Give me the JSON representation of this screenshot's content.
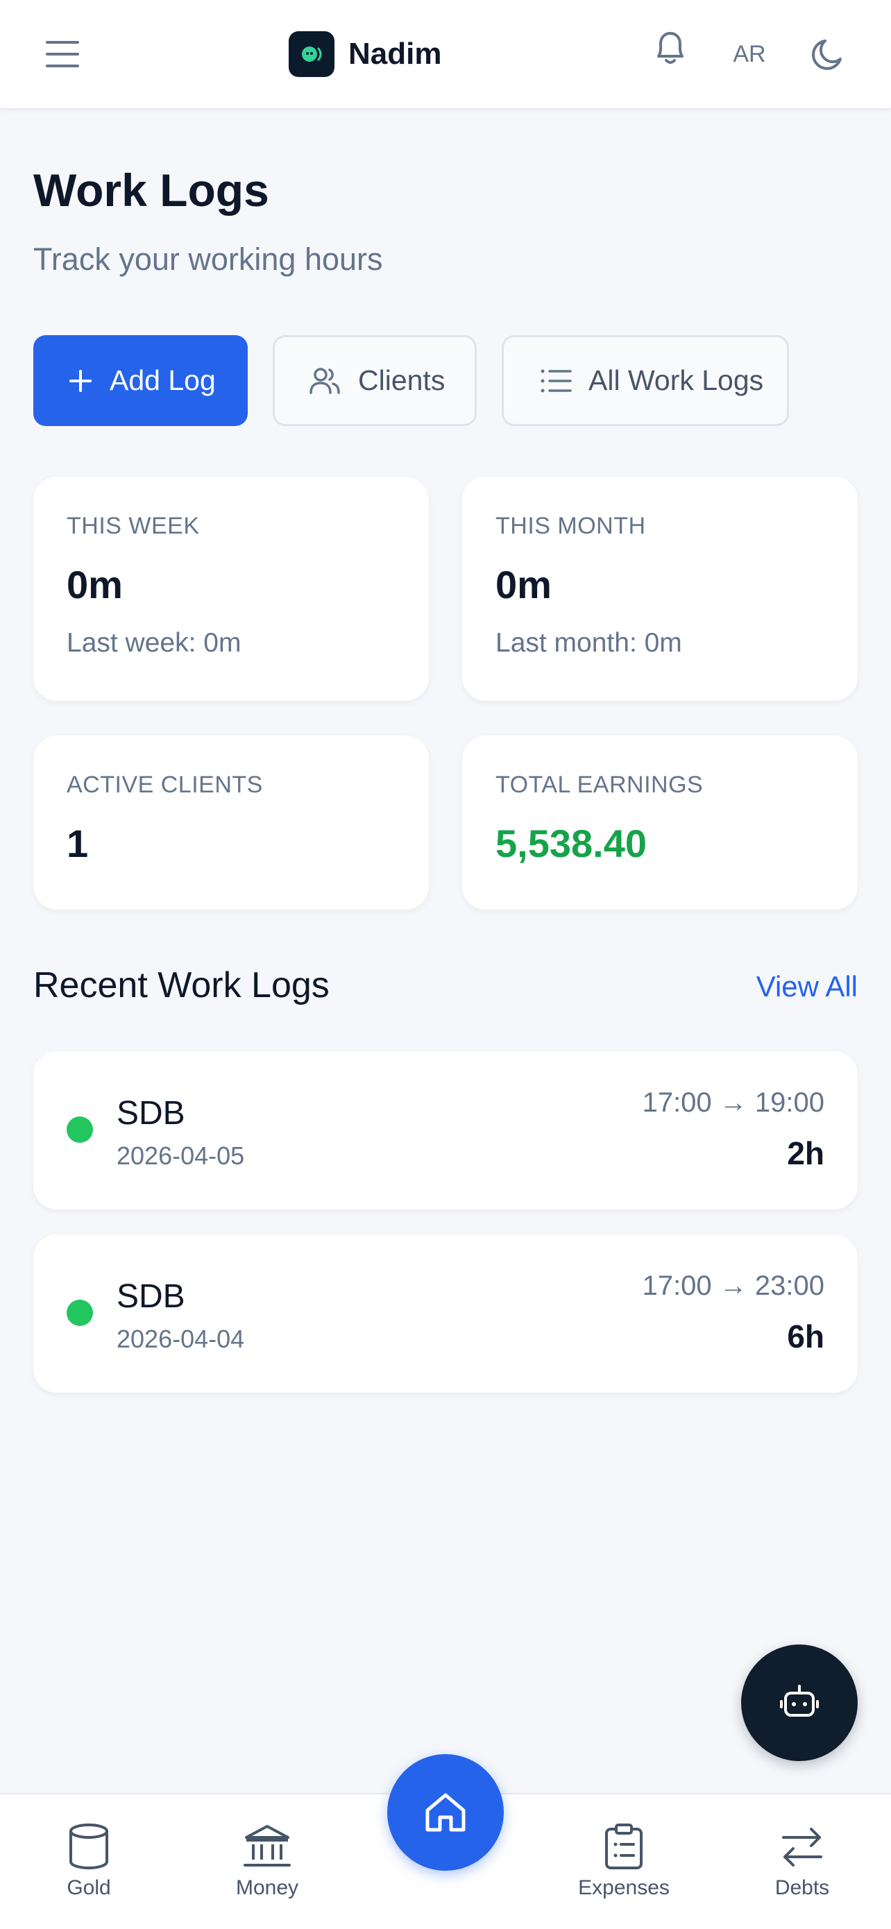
{
  "header": {
    "app_name": "Nadim",
    "lang_toggle": "AR",
    "icons": [
      "menu-icon",
      "app-logo",
      "bell-icon",
      "moon-icon"
    ]
  },
  "page": {
    "title": "Work Logs",
    "subtitle": "Track your working hours"
  },
  "actions": {
    "add_log": "Add Log",
    "clients": "Clients",
    "all_work_logs": "All Work Logs"
  },
  "stats": [
    {
      "label": "THIS WEEK",
      "value": "0m",
      "sub": "Last week: 0m"
    },
    {
      "label": "THIS MONTH",
      "value": "0m",
      "sub": "Last month: 0m"
    },
    {
      "label": "ACTIVE CLIENTS",
      "value": "1"
    },
    {
      "label": "TOTAL EARNINGS",
      "value": "5,538.40"
    }
  ],
  "recent": {
    "title": "Recent Work Logs",
    "view_all": "View All",
    "logs": [
      {
        "client": "SDB",
        "date": "2026-04-05",
        "time": "17:00 → 19:00",
        "duration": "2h"
      },
      {
        "client": "SDB",
        "date": "2026-04-04",
        "time": "17:00 → 23:00",
        "duration": "6h"
      }
    ]
  },
  "bottom_nav": {
    "items": [
      {
        "label": "Gold",
        "icon": "cylinder-icon"
      },
      {
        "label": "Money",
        "icon": "bank-icon"
      },
      {
        "label": "",
        "icon": "home-icon"
      },
      {
        "label": "Expenses",
        "icon": "clipboard-icon"
      },
      {
        "label": "Debts",
        "icon": "arrows-exchange-icon"
      }
    ]
  },
  "colors": {
    "primary": "#2563eb",
    "success": "#16a34a",
    "dot": "#22c55e",
    "dark": "#0f1d2c",
    "background": "#f5f7fb"
  }
}
